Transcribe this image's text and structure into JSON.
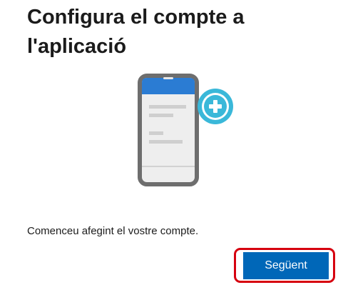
{
  "header": {
    "title": "Configura el compte a l'aplicació"
  },
  "illustration": {
    "icon": "phone-add-account-icon",
    "phone_color": "#6e6e6e",
    "header_color": "#2b7cd3",
    "plus_color": "#3ab8d9"
  },
  "main": {
    "description": "Comenceu afegint el vostre compte."
  },
  "footer": {
    "next_label": "Següent",
    "button_color": "#0067b8",
    "highlight_color": "#d6000f"
  }
}
